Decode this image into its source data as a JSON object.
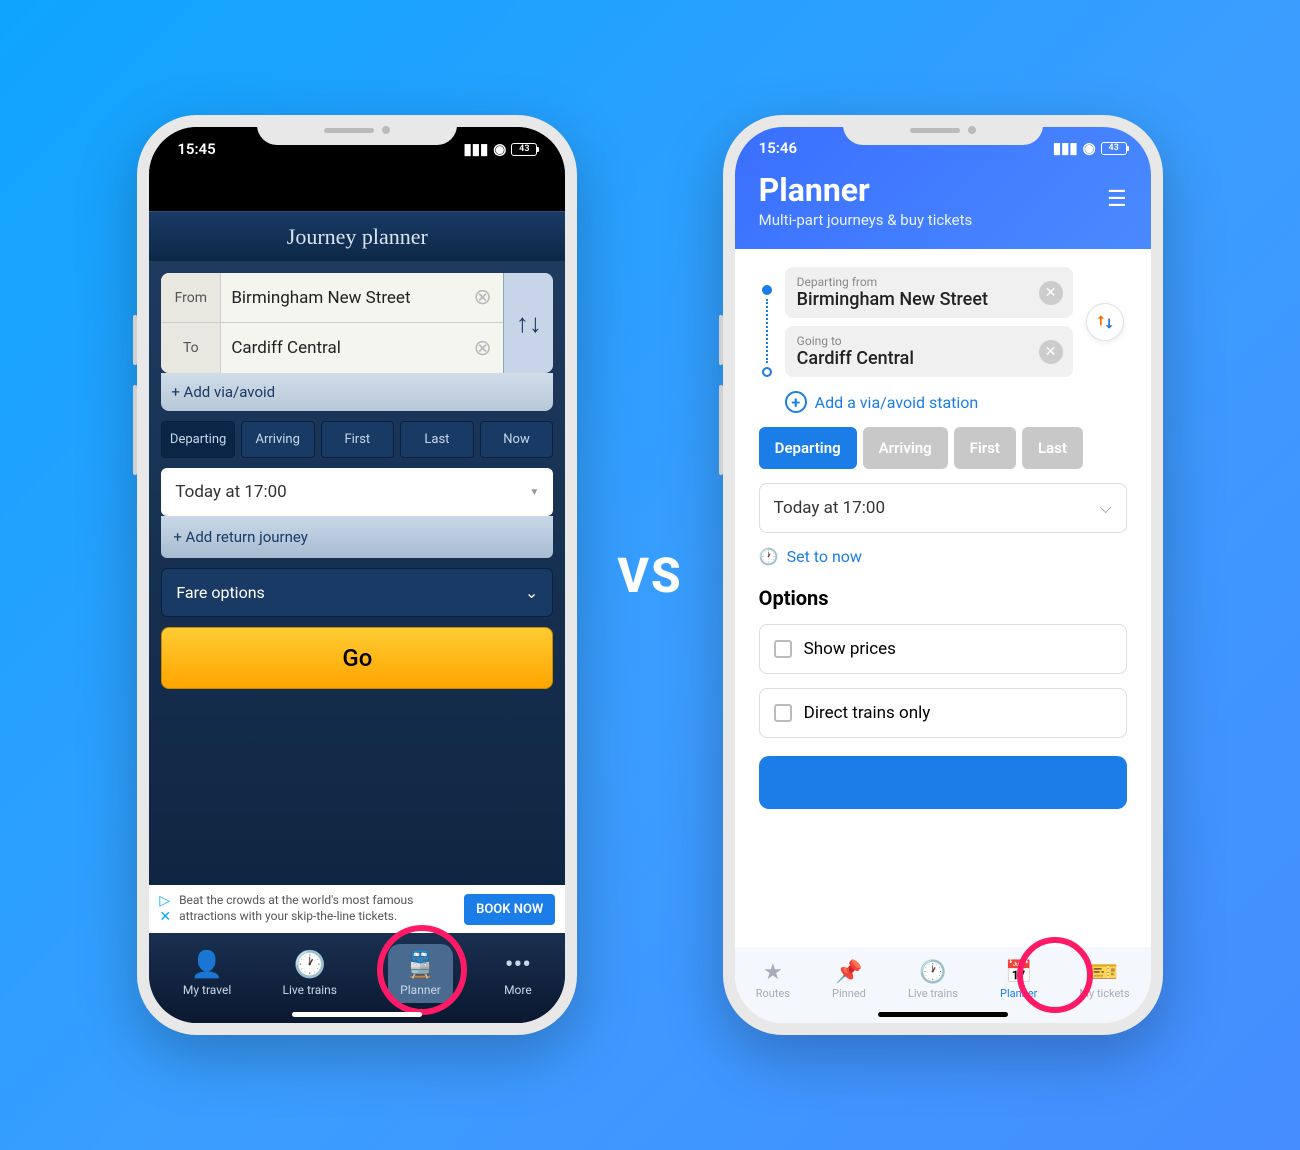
{
  "vs_label": "VS",
  "left": {
    "status": {
      "time": "15:45",
      "battery": "43"
    },
    "header": "Journey planner",
    "from_label": "From",
    "from_value": "Birmingham New Street",
    "to_label": "To",
    "to_value": "Cardiff Central",
    "add_via": "+  Add via/avoid",
    "segments": [
      "Departing",
      "Arriving",
      "First",
      "Last",
      "Now"
    ],
    "time_value": "Today at 17:00",
    "add_return": "+  Add return journey",
    "fare_options": "Fare options",
    "go": "Go",
    "ad_text": "Beat the crowds at the world's most famous attractions with your skip-the-line tickets.",
    "ad_cta": "BOOK NOW",
    "tabs": [
      {
        "icon": "👤",
        "label": "My travel"
      },
      {
        "icon": "🕐",
        "label": "Live trains"
      },
      {
        "icon": "🚆",
        "label": "Planner"
      },
      {
        "icon": "•••",
        "label": "More"
      }
    ]
  },
  "right": {
    "status": {
      "time": "15:46",
      "battery": "43"
    },
    "title": "Planner",
    "subtitle": "Multi-part journeys & buy tickets",
    "from_label": "Departing from",
    "from_value": "Birmingham New Street",
    "to_label": "Going to",
    "to_value": "Cardiff Central",
    "add_station": "Add a via/avoid station",
    "segments": [
      "Departing",
      "Arriving",
      "First",
      "Last"
    ],
    "time_value": "Today at 17:00",
    "set_now": "Set to now",
    "options_header": "Options",
    "opt_prices": "Show prices",
    "opt_direct": "Direct trains only",
    "tabs": [
      {
        "icon": "★",
        "label": "Routes"
      },
      {
        "icon": "📌",
        "label": "Pinned"
      },
      {
        "icon": "🕐",
        "label": "Live trains"
      },
      {
        "icon": "📅",
        "label": "Planner"
      },
      {
        "icon": "🎫",
        "label": "My tickets"
      }
    ]
  }
}
